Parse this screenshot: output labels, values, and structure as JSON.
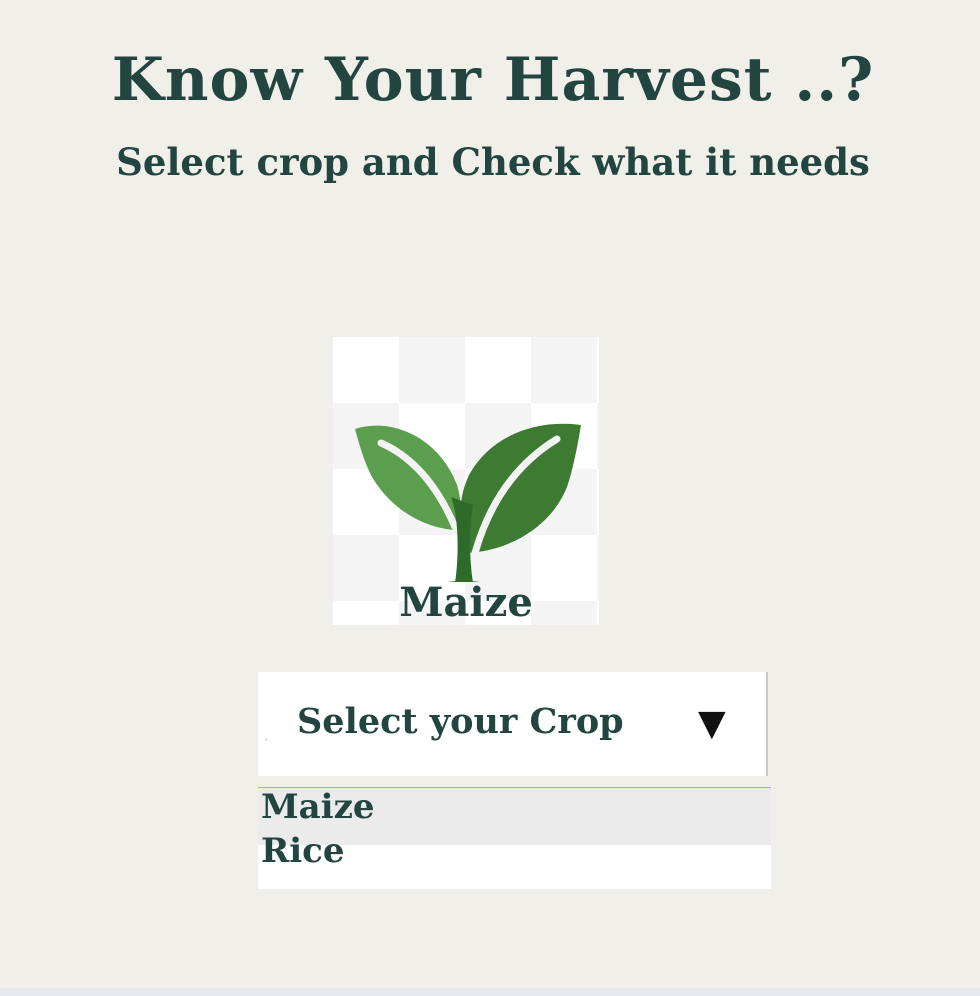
{
  "header": {
    "title": "Know Your Harvest ..?",
    "subtitle": "Select crop and Check what it needs"
  },
  "crop_card": {
    "icon": "sprout-icon",
    "name": "Maize"
  },
  "crop_select": {
    "label": "Select your Crop",
    "marker": "-",
    "arrow": "▼"
  },
  "options": [
    "Maize",
    "Rice"
  ],
  "colors": {
    "background": "#f1efea",
    "text": "#234540",
    "leaf_light": "#5a9e4e",
    "leaf_dark": "#3d7a32",
    "stem": "#2e6a2a"
  }
}
